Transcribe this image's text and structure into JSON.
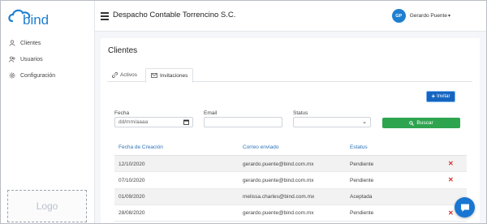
{
  "brand": {
    "logo_text": "bind",
    "accent": "#1e7fd1"
  },
  "sidebar": {
    "items": [
      {
        "label": "Clientes",
        "icon": "users-icon"
      },
      {
        "label": "Usuarios",
        "icon": "user-group-icon"
      },
      {
        "label": "Configuración",
        "icon": "gear-icon"
      }
    ],
    "logo_placeholder": "Logo"
  },
  "header": {
    "company": "Despacho Contable Torrencino S.C.",
    "user_initials": "GP",
    "user_name": "Gerardo Puente"
  },
  "main": {
    "title": "Clientes",
    "tabs": [
      {
        "label": "Activos",
        "icon": "link-icon"
      },
      {
        "label": "Invitaciones",
        "icon": "envelope-icon"
      }
    ],
    "invite_label": "Invitar",
    "filters": {
      "date_label": "Fecha",
      "date_placeholder": "dd/mm/aaaa",
      "email_label": "Email",
      "email_value": "",
      "status_label": "Status",
      "status_value": "",
      "search_label": "Buscar"
    },
    "table": {
      "headers": [
        "Fecha de Creación",
        "Correo enviado",
        "Estatus"
      ],
      "rows": [
        {
          "date": "12/10/2020",
          "email": "gerardo.puente@bind.com.mx",
          "status": "Pendiente",
          "deletable": true
        },
        {
          "date": "07/10/2020",
          "email": "gerardo.puente@bind.com.mx",
          "status": "Pendiente",
          "deletable": true
        },
        {
          "date": "01/09/2020",
          "email": "melissa.charles@bind.com.mx",
          "status": "Aceptada",
          "deletable": false
        },
        {
          "date": "28/08/2020",
          "email": "gerardo.puente@bind.com.mx",
          "status": "Pendiente",
          "deletable": true
        }
      ]
    }
  },
  "colors": {
    "invite_button": "#1565c0",
    "search_button": "#2ea44f",
    "delete": "#d32f2f",
    "header_text": "#2d73b8"
  }
}
